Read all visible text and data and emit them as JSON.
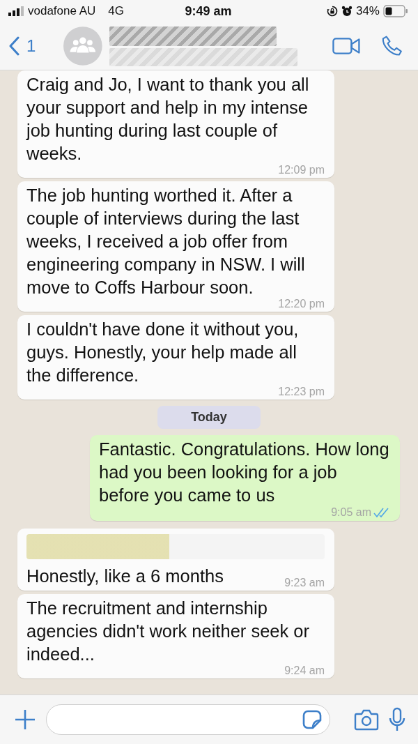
{
  "status_bar": {
    "carrier": "vodafone AU",
    "network": "4G",
    "time": "9:49 am",
    "battery": "34%"
  },
  "header": {
    "back_count": "1"
  },
  "messages": [
    {
      "kind": "incoming",
      "text": "Craig and Jo, I want to thank you all your support and help in my intense job hunting during last couple of weeks.",
      "time": "12:09 pm"
    },
    {
      "kind": "incoming",
      "text": "The job hunting worthed it. After a couple of interviews during the last weeks, I received a job offer from engineering company in NSW. I will move to Coffs Harbour soon.",
      "time": "12:20 pm"
    },
    {
      "kind": "incoming",
      "text": "I couldn't have done it without you, guys. Honestly, your help made all the difference.",
      "time": "12:23 pm"
    },
    {
      "kind": "date",
      "text": "Today"
    },
    {
      "kind": "outgoing",
      "text": "Fantastic. Congratulations. How long had you been looking for a job before you came to us",
      "time": "9:05 am",
      "read": true
    },
    {
      "kind": "incoming",
      "quoted": true,
      "text": "Honestly, like a 6 months",
      "time": "9:23 am"
    },
    {
      "kind": "incoming",
      "text": "The recruitment and internship agencies didn't work neither seek or indeed...",
      "time": "9:24 am"
    }
  ]
}
